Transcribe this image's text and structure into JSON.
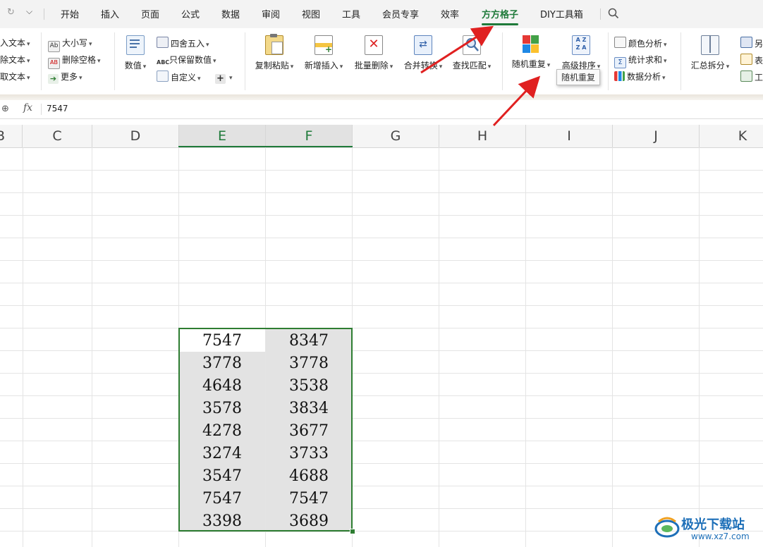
{
  "tabs": [
    "开始",
    "插入",
    "页面",
    "公式",
    "数据",
    "审阅",
    "视图",
    "工具",
    "会员专享",
    "效率",
    "方方格子",
    "DIY工具箱"
  ],
  "active_tab": "方方格子",
  "ribbon": {
    "group1": [
      "入文本",
      "除文本",
      "取文本"
    ],
    "group2": [
      "大小写",
      "删除空格",
      "更多"
    ],
    "group3_big": "数值",
    "group3": [
      "四舍五入",
      "只保留数值",
      "自定义"
    ],
    "big_buttons": [
      "复制粘贴",
      "新增插入",
      "批量删除",
      "合并转换",
      "查找匹配",
      "随机重复",
      "高级排序"
    ],
    "group5": [
      "颜色分析",
      "统计求和",
      "数据分析"
    ],
    "big_summary": "汇总拆分",
    "group6": [
      "另",
      "表",
      "工"
    ]
  },
  "tooltip": "随机重复",
  "formula_bar": {
    "fx": "fx",
    "value": "7547"
  },
  "columns": [
    "B",
    "C",
    "D",
    "E",
    "F",
    "G",
    "H",
    "I",
    "J",
    "K"
  ],
  "table": [
    [
      "7547",
      "8347"
    ],
    [
      "3778",
      "3778"
    ],
    [
      "4648",
      "3538"
    ],
    [
      "3578",
      "3834"
    ],
    [
      "4278",
      "3677"
    ],
    [
      "3274",
      "3733"
    ],
    [
      "3547",
      "4688"
    ],
    [
      "7547",
      "7547"
    ],
    [
      "3398",
      "3689"
    ]
  ],
  "watermark": {
    "name": "极光下载站",
    "url": "www.xz7.com"
  },
  "colors": {
    "accent": "#1f7a3a",
    "selection": "#2e7d32",
    "arrow": "#e02020"
  }
}
